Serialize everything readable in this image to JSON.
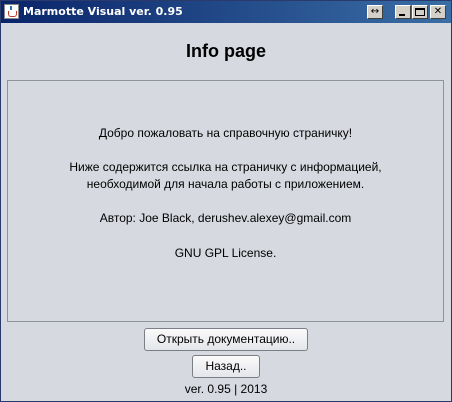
{
  "window": {
    "title": "Marmotte Visual ver. 0.95",
    "controls": {
      "resize_glyph": "↔",
      "close_glyph": "✕"
    }
  },
  "page": {
    "heading": "Info page",
    "info": {
      "welcome": "Добро пожаловать на справочную страничку!",
      "description_line1": "Ниже содержится ссылка на страничку с информацией,",
      "description_line2": "необходимой для начала работы с приложением.",
      "author": "Автор: Joe Black, derushev.alexey@gmail.com",
      "license": "GNU GPL License."
    },
    "buttons": {
      "open_docs": "Открыть документацию..",
      "back": "Назад.."
    },
    "footer": "ver. 0.95 | 2013"
  }
}
